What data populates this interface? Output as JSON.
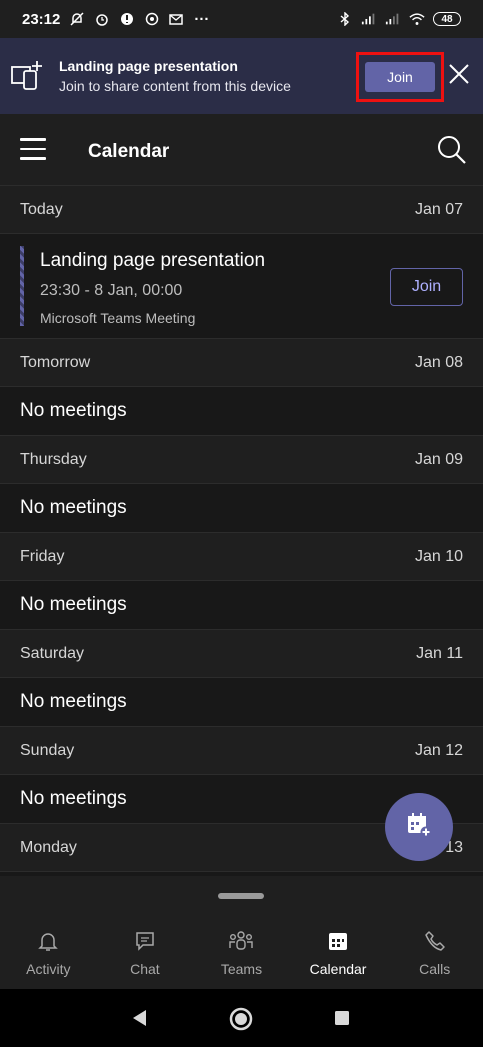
{
  "status_bar": {
    "time": "23:12",
    "dots": "···",
    "battery": "48"
  },
  "banner": {
    "title": "Landing page presentation",
    "subtitle": "Join to share content from this device",
    "join_label": "Join"
  },
  "appbar": {
    "title": "Calendar"
  },
  "days": [
    {
      "day": "Today",
      "date": "Jan 07"
    },
    {
      "day": "Tomorrow",
      "date": "Jan 08",
      "body": "No meetings"
    },
    {
      "day": "Thursday",
      "date": "Jan 09",
      "body": "No meetings"
    },
    {
      "day": "Friday",
      "date": "Jan 10",
      "body": "No meetings"
    },
    {
      "day": "Saturday",
      "date": "Jan 11",
      "body": "No meetings"
    },
    {
      "day": "Sunday",
      "date": "Jan 12",
      "body": "No meetings"
    },
    {
      "day": "Monday",
      "date": "Jan 13"
    }
  ],
  "meeting": {
    "title": "Landing page presentation",
    "time": "23:30 - 8 Jan, 00:00",
    "type": "Microsoft Teams Meeting",
    "join_label": "Join"
  },
  "nav": [
    {
      "label": "Activity",
      "icon": "bell-icon"
    },
    {
      "label": "Chat",
      "icon": "chat-icon"
    },
    {
      "label": "Teams",
      "icon": "teams-icon"
    },
    {
      "label": "Calendar",
      "icon": "calendar-icon",
      "active": true
    },
    {
      "label": "Calls",
      "icon": "phone-icon"
    }
  ],
  "colors": {
    "accent": "#6264a7",
    "banner_bg": "#2b2d47",
    "highlight": "#e11111"
  }
}
